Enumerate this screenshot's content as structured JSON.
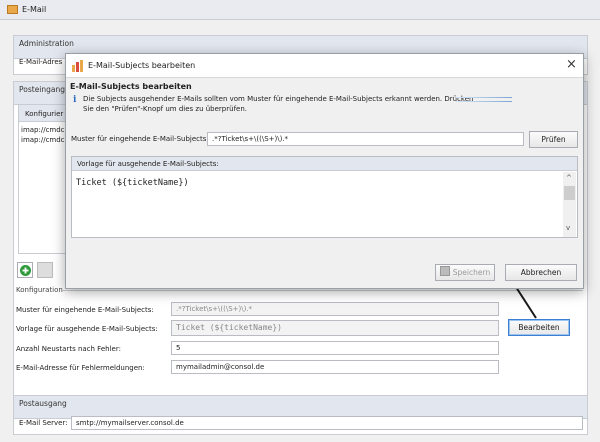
{
  "window": {
    "title": "E-Mail"
  },
  "administration": {
    "header": "Administration",
    "email_label_truncated": "E-Mail-Adres"
  },
  "posteingang": {
    "header": "Posteingang",
    "config_label_truncated": "Konfigurier",
    "imap_items": [
      "imap://cmdc",
      "imap://cmdc"
    ]
  },
  "konfiguration": {
    "header": "Konfiguration",
    "rows": [
      {
        "label": "Muster für eingehende E-Mail-Subjects:",
        "value": ".*?Ticket\\s+\\((\\S+)\\).*"
      },
      {
        "label": "Vorlage für ausgehende E-Mail-Subjects:",
        "value": "Ticket (${ticketName})"
      },
      {
        "label": "Anzahl Neustarts nach Fehler:",
        "value": "5"
      },
      {
        "label": "E-Mail-Adresse für Fehlermeldungen:",
        "value": "mymailadmin@consol.de"
      }
    ],
    "edit_button": "Bearbeiten"
  },
  "postausgang": {
    "header": "Postausgang",
    "server_label": "E-Mail Server:",
    "server_value": "smtp://mymailserver.consol.de"
  },
  "dialog": {
    "title": "E-Mail-Subjects bearbeiten",
    "heading": "E-Mail-Subjects bearbeiten",
    "info_line1": "Die Subjects ausgehender E-Mails sollten vom Muster für eingehende E-Mail-Subjects erkannt werden. Drücken",
    "info_line2": "Sie den \"Prüfen\"-Knopf um dies zu überprüfen.",
    "pattern_label": "Muster für eingehende E-Mail-Subjects:",
    "pattern_value": ".*?Ticket\\s+\\((\\S+)\\).*",
    "check_button": "Prüfen",
    "template_header": "Vorlage für ausgehende E-Mail-Subjects:",
    "template_value": "Ticket (${ticketName})",
    "save_button": "Speichern",
    "cancel_button": "Abbrechen",
    "close_glyph": "×"
  },
  "colors": {
    "accent_blue": "#3c7fd0",
    "panel_header": "#e2e6ee",
    "add_green": "#2e9a3a",
    "arrow": "#1a1a1a"
  },
  "icons": [
    "mail-icon",
    "add-icon",
    "info-icon",
    "close-icon",
    "save-icon",
    "scroll-up-icon",
    "scroll-down-icon"
  ]
}
